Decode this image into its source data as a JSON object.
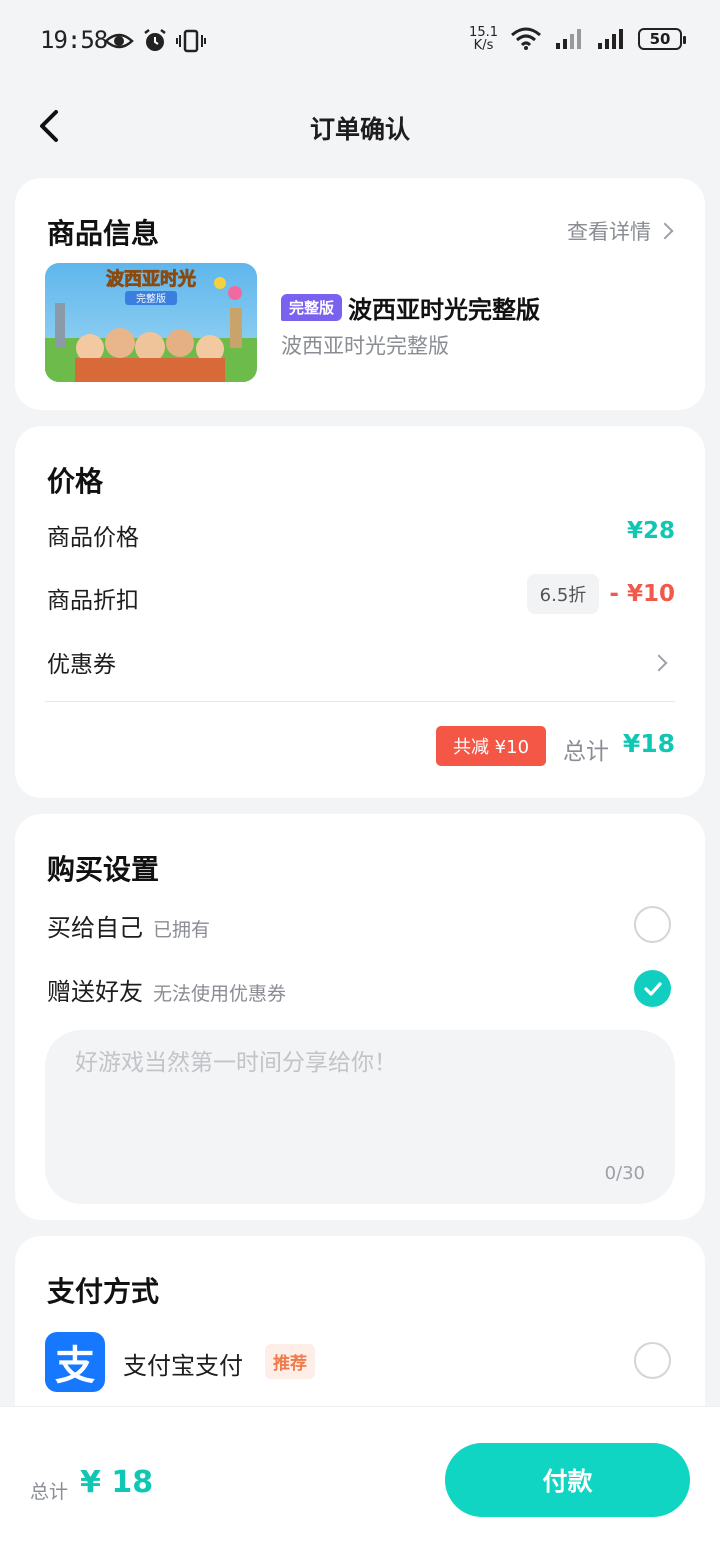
{
  "status_bar": {
    "time": "19:58",
    "net_speed_value": "15.1",
    "net_speed_unit": "K/s",
    "battery": "50"
  },
  "nav": {
    "title": "订单确认"
  },
  "product": {
    "section_title": "商品信息",
    "view_detail": "查看详情",
    "cover_title": "波西亚时光",
    "cover_sub": "完整版",
    "edition_badge": "完整版",
    "name": "波西亚时光完整版",
    "subtitle": "波西亚时光完整版"
  },
  "price": {
    "section_title": "价格",
    "rows": [
      {
        "label": "商品价格",
        "value": "¥28"
      },
      {
        "label": "商品折扣",
        "chip": "6.5折",
        "value": "- ¥10"
      },
      {
        "label": "优惠券"
      }
    ],
    "total_reduce": "共减 ¥10",
    "total_label": "总计",
    "total_value": "¥18"
  },
  "settings": {
    "section_title": "购买设置",
    "options": [
      {
        "label": "买给自己",
        "note": "已拥有",
        "checked": false
      },
      {
        "label": "赠送好友",
        "note": "无法使用优惠券",
        "checked": true
      }
    ],
    "message_placeholder": "好游戏当然第一时间分享给你！",
    "char_count": "0/30"
  },
  "payment": {
    "section_title": "支付方式",
    "logo_glyph": "支",
    "method_label": "支付宝支付",
    "recommend_tag": "推荐"
  },
  "bottom": {
    "total_label": "总计",
    "total_value": "¥ 18",
    "pay_button": "付款"
  },
  "colors": {
    "accent": "#10c7b4",
    "discount_red": "#f05a4a",
    "badge_purple": "#7b61f0",
    "alipay_blue": "#1677ff"
  }
}
